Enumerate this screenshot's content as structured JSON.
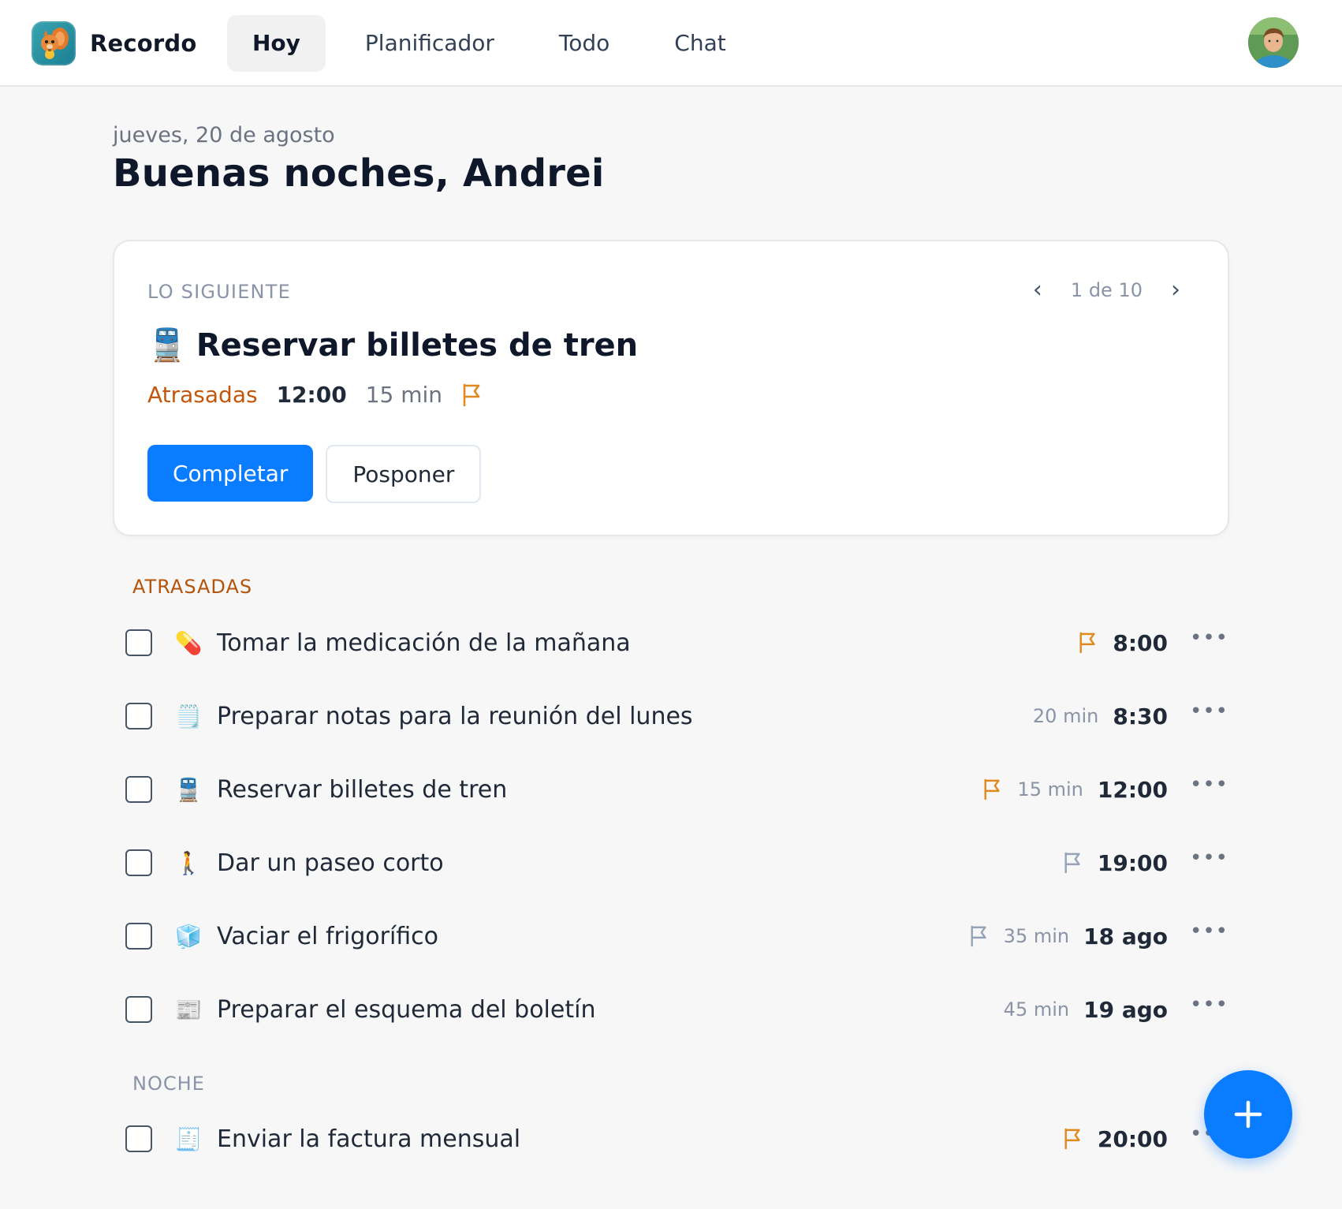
{
  "app": {
    "name": "Recordo"
  },
  "nav": {
    "tabs": [
      {
        "label": "Hoy",
        "active": true
      },
      {
        "label": "Planificador",
        "active": false
      },
      {
        "label": "Todo",
        "active": false
      },
      {
        "label": "Chat",
        "active": false
      }
    ]
  },
  "header": {
    "date": "jueves, 20 de agosto",
    "greeting": "Buenas noches, Andrei"
  },
  "next": {
    "label": "LO SIGUIENTE",
    "pager": "1 de 10",
    "emoji": "🚆",
    "title": "Reservar billetes de tren",
    "status": "Atrasadas",
    "time": "12:00",
    "duration": "15 min",
    "complete_label": "Completar",
    "postpone_label": "Posponer"
  },
  "sections": {
    "overdue_label": "ATRASADAS",
    "night_label": "NOCHE"
  },
  "tasks_overdue": [
    {
      "emoji": "💊",
      "title": "Tomar la medicación de la mañana",
      "duration": "",
      "time": "8:00",
      "flag": "orange"
    },
    {
      "emoji": "🗒️",
      "title": "Preparar notas para la reunión del lunes",
      "duration": "20 min",
      "time": "8:30",
      "flag": "none"
    },
    {
      "emoji": "🚆",
      "title": "Reservar billetes de tren",
      "duration": "15 min",
      "time": "12:00",
      "flag": "orange"
    },
    {
      "emoji": "🚶",
      "title": "Dar un paseo corto",
      "duration": "",
      "time": "19:00",
      "flag": "gray"
    },
    {
      "emoji": "🧊",
      "title": "Vaciar el frigorífico",
      "duration": "35 min",
      "time": "18 ago",
      "flag": "gray"
    },
    {
      "emoji": "📰",
      "title": "Preparar el esquema del boletín",
      "duration": "45 min",
      "time": "19 ago",
      "flag": "none"
    }
  ],
  "tasks_night": [
    {
      "emoji": "🧾",
      "title": "Enviar la factura mensual",
      "duration": "",
      "time": "20:00",
      "flag": "orange"
    }
  ],
  "colors": {
    "accent": "#0a7cff",
    "overdue": "#c2570c",
    "flag_orange": "#e08a1e",
    "flag_gray": "#94a3b8"
  },
  "icons": {
    "more": "more-horizontal-icon",
    "flag": "flag-icon",
    "add": "plus-icon",
    "prev": "chevron-left-icon",
    "next": "chevron-right-icon"
  }
}
